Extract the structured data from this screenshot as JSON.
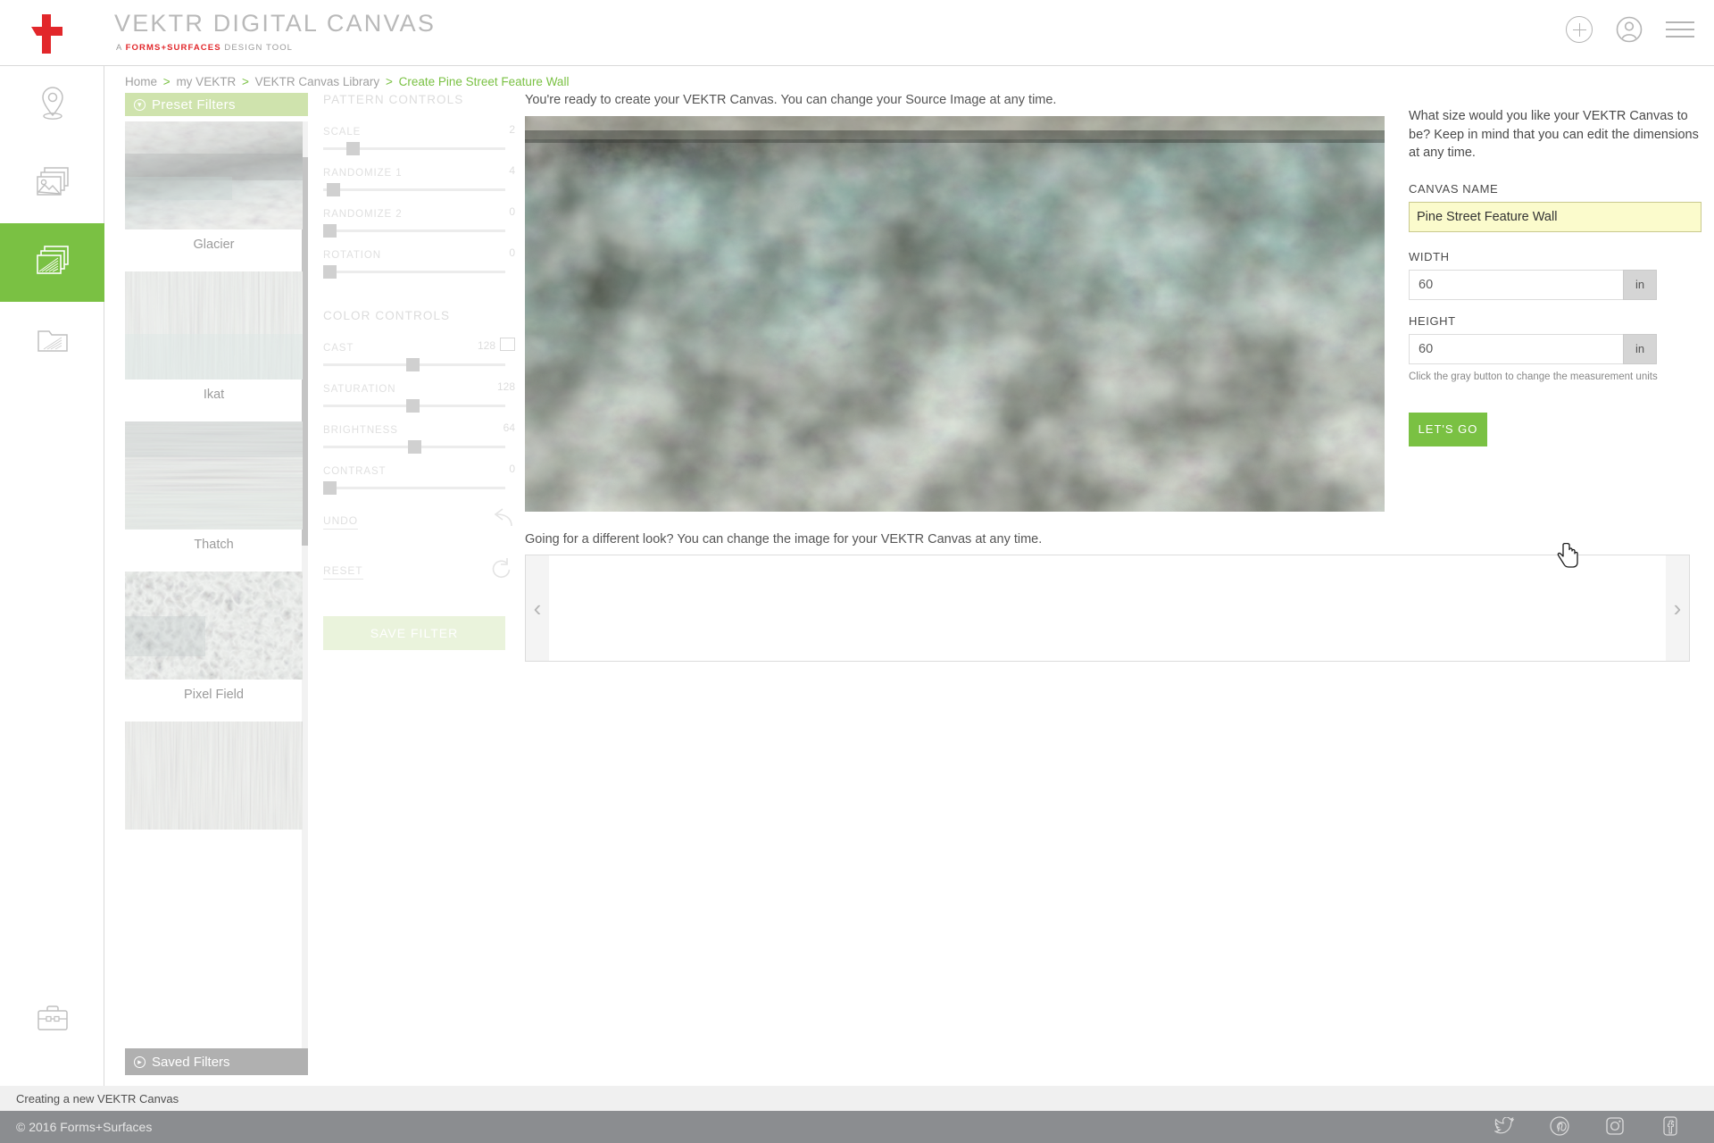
{
  "header": {
    "brand_title": "VEKTR DIGITAL CANVAS",
    "brand_sub_pre": "A ",
    "brand_sub_brand": "FORMS+SURFACES",
    "brand_sub_post": " DESIGN TOOL",
    "icons": [
      "add-icon",
      "account-icon",
      "menu-icon"
    ]
  },
  "rail": {
    "items": [
      {
        "name": "location-icon"
      },
      {
        "name": "images-icon"
      },
      {
        "name": "canvas-icon",
        "active": true
      },
      {
        "name": "folder-icon"
      }
    ],
    "bottom": {
      "name": "toolbox-icon"
    }
  },
  "breadcrumb": {
    "items": [
      "Home",
      "my VEKTR",
      "VEKTR Canvas Library"
    ],
    "current": "Create Pine Street Feature Wall",
    "separator": ">"
  },
  "filters": {
    "header": "Preset Filters",
    "footer": "Saved Filters",
    "items": [
      {
        "label": "Glacier"
      },
      {
        "label": "Ikat"
      },
      {
        "label": "Thatch"
      },
      {
        "label": "Pixel Field"
      },
      {
        "label": ""
      }
    ]
  },
  "pattern_controls": {
    "title": "PATTERN CONTROLS",
    "sliders": [
      {
        "label": "SCALE",
        "value": "2",
        "pct": 13
      },
      {
        "label": "RANDOMIZE 1",
        "value": "4",
        "pct": 2
      },
      {
        "label": "RANDOMIZE 2",
        "value": "0",
        "pct": 0
      },
      {
        "label": "ROTATION",
        "value": "0",
        "pct": 0
      }
    ]
  },
  "color_controls": {
    "title": "COLOR CONTROLS",
    "sliders": [
      {
        "label": "CAST",
        "value": "128",
        "pct": 49,
        "swatch": "#ffffff"
      },
      {
        "label": "SATURATION",
        "value": "128",
        "pct": 49
      },
      {
        "label": "BRIGHTNESS",
        "value": "64",
        "pct": 49
      },
      {
        "label": "CONTRAST",
        "value": "0",
        "pct": 0
      }
    ],
    "undo_label": "UNDO",
    "reset_label": "RESET",
    "save_filter_label": "SAVE FILTER"
  },
  "main": {
    "top_message": "You're ready to create your VEKTR Canvas. You can change your Source Image at any time.",
    "bottom_message": "Going for a different look? You can change the image for your VEKTR Canvas at any time.",
    "carousel_prev": "‹",
    "carousel_next": "›"
  },
  "side_panel": {
    "intro": "What size would you like your VEKTR Canvas to be? Keep in mind that you can edit the dimensions at any time.",
    "canvas_name_label": "CANVAS NAME",
    "canvas_name_value": "Pine Street Feature Wall",
    "width_label": "WIDTH",
    "width_value": "60",
    "width_unit": "in",
    "height_label": "HEIGHT",
    "height_value": "60",
    "height_unit": "in",
    "units_hint": "Click the gray button to change the measurement units",
    "lets_go_label": "LET'S GO"
  },
  "footer": {
    "status": "Creating a new VEKTR Canvas",
    "copyright": "© 2016 Forms+Surfaces",
    "social": [
      "twitter-icon",
      "pinterest-icon",
      "instagram-icon",
      "facebook-icon"
    ]
  },
  "colors": {
    "accent_green": "#7ac143",
    "brand_red": "#e2272b",
    "highlight_yellow": "#fbfbcc"
  }
}
